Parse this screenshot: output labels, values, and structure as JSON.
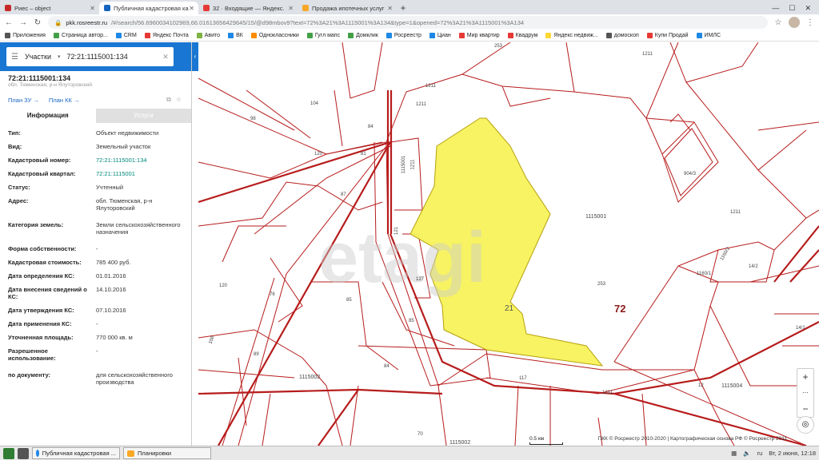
{
  "browser": {
    "tabs": [
      {
        "label": "Риес – object",
        "icon_color": "#c62828"
      },
      {
        "label": "Публичная кадастровая ка",
        "icon_color": "#1565c0",
        "active": true
      },
      {
        "label": "32 · Входящие — Яндекс.",
        "icon_color": "#e53935"
      },
      {
        "label": "Продажа ипотечных услуг",
        "icon_color": "#f9a825"
      }
    ],
    "url_host": "pkk.rosreestr.ru",
    "url_rest": "/#/search/56.6960034102969,66.01613656429645/15/@d98mbov9?text=72%3A21%3A1115001%3A134&type=1&opened=72%3A21%3A1115001%3A134",
    "bookmarks": [
      {
        "label": "Приложения",
        "color": "#555"
      },
      {
        "label": "Страница автор...",
        "color": "#43a047"
      },
      {
        "label": "CRM",
        "color": "#1e88e5"
      },
      {
        "label": "Яндекс Почта",
        "color": "#e53935"
      },
      {
        "label": "Авито",
        "color": "#7cb342"
      },
      {
        "label": "ВК",
        "color": "#1e88e5"
      },
      {
        "label": "Одноклассники",
        "color": "#fb8c00"
      },
      {
        "label": "Гугл мапс",
        "color": "#43a047"
      },
      {
        "label": "Домклик",
        "color": "#43a047"
      },
      {
        "label": "Росреестр",
        "color": "#1e88e5"
      },
      {
        "label": "Циан",
        "color": "#1e88e5"
      },
      {
        "label": "Мир квартир",
        "color": "#e53935"
      },
      {
        "label": "Квадрум",
        "color": "#e53935"
      },
      {
        "label": "Яндекс недвиж...",
        "color": "#fdd835"
      },
      {
        "label": "домоскоп",
        "color": "#555"
      },
      {
        "label": "Купи Продай",
        "color": "#e53935"
      },
      {
        "label": "ИМЛС",
        "color": "#1e88e5"
      }
    ]
  },
  "search": {
    "category": "Участки",
    "query": "72:21:1115001:134"
  },
  "object": {
    "title": "72:21:1115001:134",
    "subtitle": "обл. Тюменская, р-н Ялуторовский",
    "plan_zu": "План ЗУ →",
    "plan_kk": "План КК →",
    "tab_info": "Информация",
    "tab_services": "Услуги",
    "fields": [
      {
        "k": "Тип:",
        "v": "Объект недвижимости"
      },
      {
        "k": "Вид:",
        "v": "Земельный участок"
      },
      {
        "k": "Кадастровый номер:",
        "v": "72:21:1115001:134",
        "link": true
      },
      {
        "k": "Кадастровый квартал:",
        "v": "72:21:1115001",
        "link": true
      },
      {
        "k": "Статус:",
        "v": "Учтенный"
      },
      {
        "k": "Адрес:",
        "v": "обл. Тюменская, р-н Ялуторовский"
      },
      {
        "k": "Категория земель:",
        "v": "Земли сельскохозяйственного назначения"
      },
      {
        "k": "Форма собственности:",
        "v": "-"
      },
      {
        "k": "Кадастровая стоимость:",
        "v": "785 400 руб."
      },
      {
        "k": "Дата определения КС:",
        "v": "01.01.2016"
      },
      {
        "k": "Дата внесения сведений о КС:",
        "v": "14.10.2016"
      },
      {
        "k": "Дата утверждения КС:",
        "v": "07.10.2016"
      },
      {
        "k": "Дата применения КС:",
        "v": "-"
      },
      {
        "k": "Уточненная площадь:",
        "v": "770 000 кв. м"
      },
      {
        "k": "Разрешенное использование:",
        "v": "-"
      },
      {
        "k": "по документу:",
        "v": "для сельскохозяйственного производства"
      }
    ]
  },
  "map": {
    "parcel_color": "#f7f35a",
    "line_color": "#b71c1c",
    "labels": [
      "253",
      "1211",
      "104",
      "98",
      "1211",
      "1211",
      "84",
      "1115001",
      "120",
      "81",
      "87",
      "1211",
      "904/3",
      "1115001",
      "1211",
      "1160/2",
      "14/2",
      "1160/1",
      "127",
      "253",
      "121",
      "21",
      "72",
      "14/1",
      "120",
      "76",
      "85",
      "85",
      "89",
      "84",
      "117",
      "1115002",
      "12",
      "1115004",
      "70",
      "1115002",
      "1211",
      "108"
    ],
    "watermark": "etagi",
    "scale_label": "0.5 км",
    "copyright": "ПКК © Росреестр 2010-2020 | Картографическая основа РФ © Росреестр 2011"
  },
  "taskbar": {
    "tasks": [
      "Публичная кадастровая ...",
      "Планировки"
    ],
    "lang": "ru",
    "clock": "Вт, 2 июня, 12:18"
  }
}
